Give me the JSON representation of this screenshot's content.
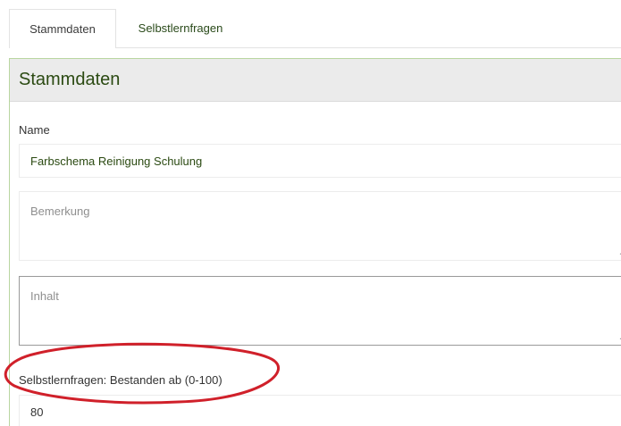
{
  "tabs": [
    {
      "label": "Stammdaten",
      "active": true
    },
    {
      "label": "Selbstlernfragen",
      "active": false
    }
  ],
  "panel": {
    "title": "Stammdaten"
  },
  "form": {
    "name_label": "Name",
    "name_value": "Farbschema Reinigung Schulung",
    "bemerkung_placeholder": "Bemerkung",
    "inhalt_placeholder": "Inhalt",
    "bestanden_label": "Selbstlernfragen: Bestanden ab (0-100)",
    "bestanden_value": "80"
  },
  "colors": {
    "accent_green": "#2b4a12",
    "panel_border": "#b9d6a0",
    "annotation_red": "#d0202a"
  }
}
